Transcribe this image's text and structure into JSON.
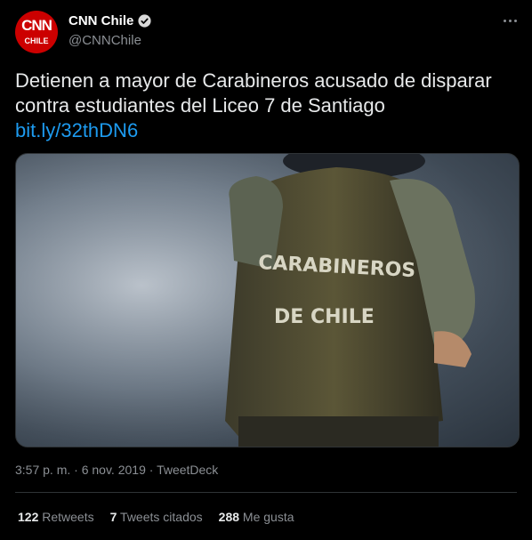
{
  "account": {
    "display_name": "CNN Chile",
    "handle": "@CNNChile",
    "logo_top": "CNN",
    "logo_bottom": "CHILE",
    "verified": true
  },
  "tweet": {
    "text": "Detienen a mayor de Carabineros acusado de disparar contra estudiantes del Liceo 7 de Santiago",
    "link": "bit.ly/32thDN6"
  },
  "media": {
    "vest_line1": "CARABINEROS",
    "vest_line2": "DE CHILE"
  },
  "meta": {
    "time": "3:57 p. m.",
    "separator": "·",
    "date": "6 nov. 2019",
    "source": "TweetDeck"
  },
  "stats": {
    "retweets_count": "122",
    "retweets_label": "Retweets",
    "quotes_count": "7",
    "quotes_label": "Tweets citados",
    "likes_count": "288",
    "likes_label": "Me gusta"
  },
  "colors": {
    "background": "#000000",
    "link": "#1d9bf0",
    "brand": "#cc0000",
    "muted": "#8b8f94"
  }
}
